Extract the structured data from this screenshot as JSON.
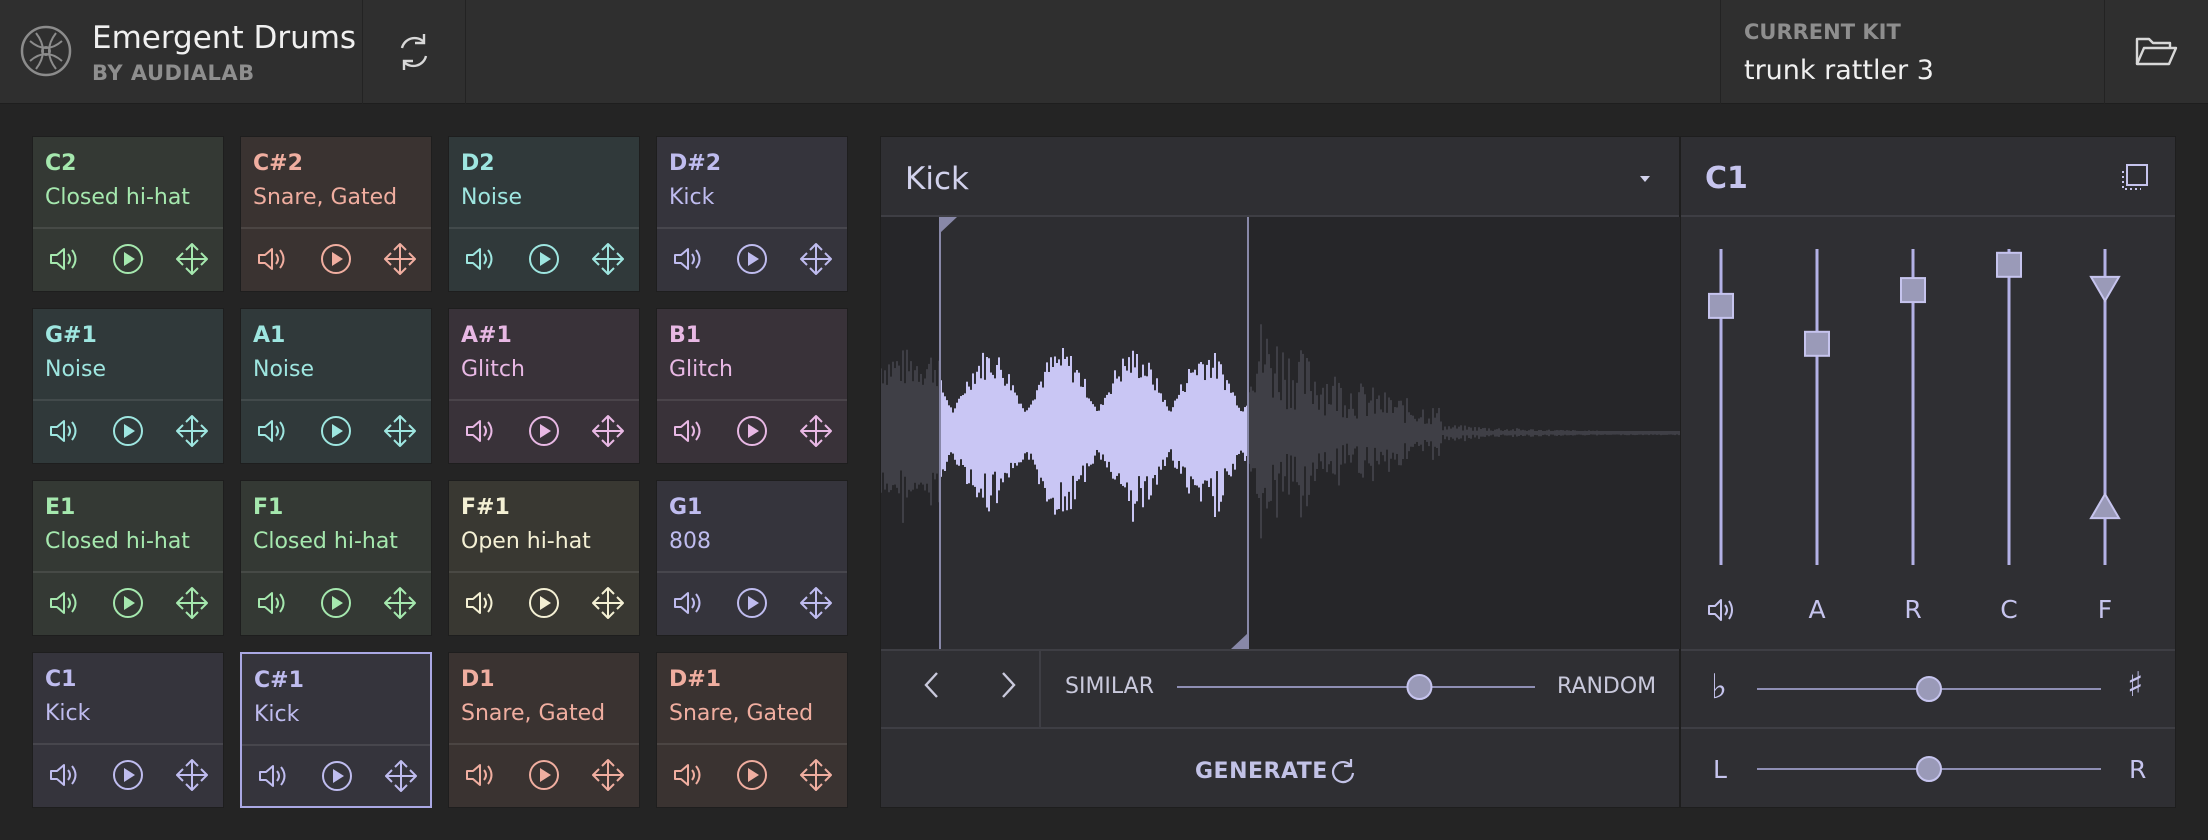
{
  "header": {
    "app_title": "Emergent Drums",
    "app_subtitle": "BY AUDIALAB",
    "current_kit_label": "CURRENT KIT",
    "current_kit_name": "trunk rattler 3"
  },
  "pads": [
    {
      "note": "C2",
      "name": "Closed hi-hat",
      "color": "#a5e8ae"
    },
    {
      "note": "C#2",
      "name": "Snare, Gated",
      "color": "#f0aea0"
    },
    {
      "note": "D2",
      "name": "Noise",
      "color": "#9ee6e0"
    },
    {
      "note": "D#2",
      "name": "Kick",
      "color": "#bfbcef"
    },
    {
      "note": "G#1",
      "name": "Noise",
      "color": "#9ee6e0"
    },
    {
      "note": "A1",
      "name": "Noise",
      "color": "#9ee6e0"
    },
    {
      "note": "A#1",
      "name": "Glitch",
      "color": "#e8b8e4"
    },
    {
      "note": "B1",
      "name": "Glitch",
      "color": "#e8b8e4"
    },
    {
      "note": "E1",
      "name": "Closed hi-hat",
      "color": "#a5e8ae"
    },
    {
      "note": "F1",
      "name": "Closed hi-hat",
      "color": "#a5e8ae"
    },
    {
      "note": "F#1",
      "name": "Open hi-hat",
      "color": "#f4f0d4"
    },
    {
      "note": "G1",
      "name": "808",
      "color": "#bfbcef"
    },
    {
      "note": "C1",
      "name": "Kick",
      "color": "#bfbcef"
    },
    {
      "note": "C#1",
      "name": "Kick",
      "color": "#bfbcef",
      "selected": true
    },
    {
      "note": "D1",
      "name": "Snare, Gated",
      "color": "#f0aea0"
    },
    {
      "note": "D#1",
      "name": "Snare, Gated",
      "color": "#f0aea0"
    }
  ],
  "pad_icons": [
    "speaker-icon",
    "play-icon",
    "drag-icon"
  ],
  "editor": {
    "sample_type": "Kick",
    "similar_label": "SIMILAR",
    "random_label": "RANDOM",
    "similarity_value": 0.69,
    "generate_label": "GENERATE"
  },
  "envelope": {
    "note": "C1",
    "sliders": [
      {
        "label": "",
        "icon": "volume-icon",
        "value": 0.82
      },
      {
        "label": "A",
        "value": 0.7
      },
      {
        "label": "R",
        "value": 0.87
      },
      {
        "label": "C",
        "value": 0.95
      },
      {
        "label": "F",
        "value_high": 0.88,
        "value_low": 0.18
      }
    ],
    "flat_symbol": "♭",
    "sharp_symbol": "♯",
    "pitch_value": 0.5,
    "pan_left_label": "L",
    "pan_right_label": "R",
    "pan_value": 0.5
  },
  "colors": {
    "accent": "#aaa8e4",
    "background": "#242424",
    "panel": "#2f2f33"
  }
}
